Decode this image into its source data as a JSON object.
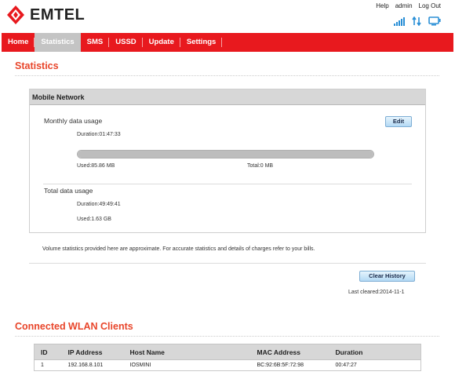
{
  "brand": {
    "name": "EMTEL",
    "color": "#e8191e"
  },
  "top_links": {
    "help": "Help",
    "user": "admin",
    "logout": "Log Out"
  },
  "status_icons": [
    "signal-icon",
    "data-transfer-icon",
    "monitor-icon"
  ],
  "nav": {
    "items": [
      {
        "label": "Home",
        "active": false
      },
      {
        "label": "Statistics",
        "active": true
      },
      {
        "label": "SMS",
        "active": false
      },
      {
        "label": "USSD",
        "active": false
      },
      {
        "label": "Update",
        "active": false
      },
      {
        "label": "Settings",
        "active": false
      }
    ]
  },
  "page": {
    "title": "Statistics"
  },
  "mobile_network": {
    "title": "Mobile Network",
    "monthly": {
      "label": "Monthly data usage",
      "edit_label": "Edit",
      "duration": "Duration:01:47:33",
      "used": "Used:85.86 MB",
      "total": "Total:0 MB",
      "progress_fraction": 1.0
    },
    "total": {
      "label": "Total data usage",
      "duration": "Duration:49:49:41",
      "used": "Used:1.63 GB"
    }
  },
  "disclaimer": "Volume statistics provided here are approximate. For accurate statistics and details of charges refer to your bills.",
  "history": {
    "clear_label": "Clear History",
    "last_cleared": "Last cleared:2014-11-1"
  },
  "wlan": {
    "title": "Connected WLAN Clients",
    "columns": [
      "ID",
      "IP Address",
      "Host Name",
      "MAC Address",
      "Duration"
    ],
    "rows": [
      [
        "1",
        "192.168.8.101",
        "IOSMINI",
        "BC:92:6B:5F:72:98",
        "00:47:27"
      ]
    ]
  }
}
